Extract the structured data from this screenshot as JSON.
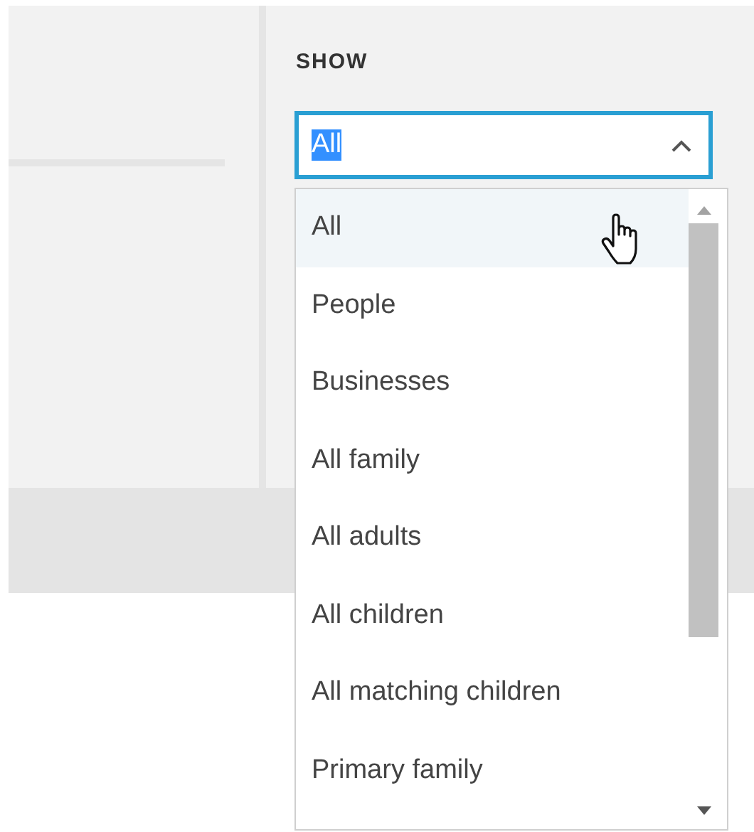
{
  "show_filter": {
    "label": "SHOW",
    "value": "All",
    "value_highlighted": true,
    "expanded": true,
    "options": [
      {
        "label": "All",
        "selected": true
      },
      {
        "label": "People",
        "selected": false
      },
      {
        "label": "Businesses",
        "selected": false
      },
      {
        "label": "All family",
        "selected": false
      },
      {
        "label": "All adults",
        "selected": false
      },
      {
        "label": "All children",
        "selected": false
      },
      {
        "label": "All matching children",
        "selected": false
      },
      {
        "label": "Primary family",
        "selected": false
      }
    ]
  }
}
